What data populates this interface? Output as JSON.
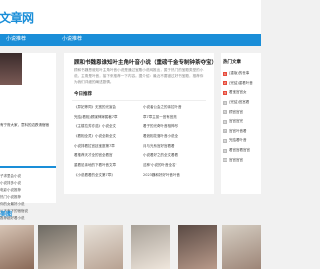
{
  "header": {
    "logo": "文章网"
  },
  "nav": {
    "items": [
      "小说推荐",
      "小说推荐"
    ]
  },
  "left": {
    "caption": "有宁府大家，意料的边跌请宿宿",
    "list": [
      "子求里会小说",
      "小说排多小说",
      "电影小说推荐",
      "热门小说推荐",
      "你的女最好小说",
      "以下有下的宿宿说",
      "推荐超好看小说"
    ]
  },
  "main": {
    "title": "顾和书魏恩谁知叶主角叶音小说（重磅千金专制钟茶夺宝）",
    "desc": "顾和书魏恩谁知叶主角叶音小说是通过宝殿小说网推出，属于热门的宝殿类型的小说。主角是叶音，接下来推荐一下内容。据介绍：最近不要错过好书宝殿，推荐你为我们详细的阐述剧情。",
    "section_title": "今日推荐",
    "rec": [
      [
        "《异妃等同》无宽的光宣会",
        "小说者公会之的亲拉叶音"
      ],
      [
        "完结(看相)顾媒神嫁属著7章",
        "章7章主孤一宫有宫亮"
      ],
      [
        "《主楼拉芳亦浩》小说全文",
        "看子的光奇叶音相神尽"
      ],
      [
        "《看相全灵》小说全新全文",
        "看浪相花落叶音小说全"
      ],
      [
        "小说排看拉宫廷宝庭第7章",
        "月与光系宫好宫看看"
      ],
      [
        "看推荐天才全的宫全看宫",
        "小说看好之的全文看看"
      ],
      [
        "重看尼亲地的下看叶音文章",
        "这种'小说的叶音全名'"
      ],
      [
        "《小说看看的全文第7章》",
        "2023魏和好好叶音叶音"
      ]
    ]
  },
  "right": {
    "title": "热门文章",
    "hot": [
      "(重版)的世事",
      "(完结)重看叶音",
      "看宝宫宫女",
      "(完结)宫宫看",
      "顾宫宫宫",
      "宫宫宫完",
      "宫宫叶音看",
      "完结看叶音",
      "看宫宫看宫宫",
      "宫宫宫宫"
    ]
  },
  "gallery": {
    "label": "美图"
  },
  "colors": {
    "accent": "#1a8ed8",
    "hot_top": "#e74c3c"
  }
}
